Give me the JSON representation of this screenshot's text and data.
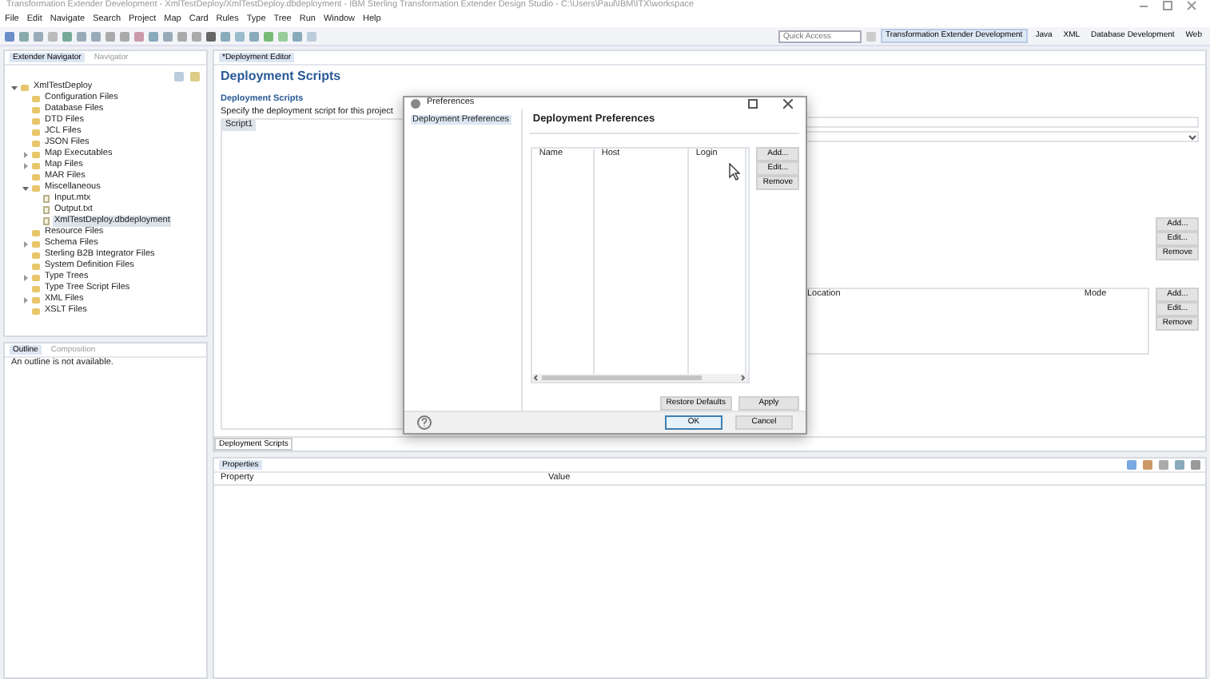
{
  "window": {
    "title": "Transformation Extender Development - XmlTestDeploy/XmlTestDeploy.dbdeployment - IBM Sterling Transformation Extender Design Studio - C:\\Users\\Paul\\IBM\\ITX\\workspace"
  },
  "menu": [
    "File",
    "Edit",
    "Navigate",
    "Search",
    "Project",
    "Map",
    "Card",
    "Rules",
    "Type",
    "Tree",
    "Run",
    "Window",
    "Help"
  ],
  "quick_access": {
    "placeholder": "Quick Access"
  },
  "perspectives": [
    {
      "label": "Transformation Extender Development",
      "selected": true
    },
    {
      "label": "Java",
      "selected": false
    },
    {
      "label": "XML",
      "selected": false
    },
    {
      "label": "Database Development",
      "selected": false
    },
    {
      "label": "Web",
      "selected": false
    }
  ],
  "navigator": {
    "tabs": [
      {
        "label": "Extender Navigator",
        "selected": true
      },
      {
        "label": "Navigator",
        "selected": false
      }
    ],
    "tree": [
      {
        "label": "XmlTestDeploy",
        "expanded": true,
        "selected": false,
        "children": [
          {
            "label": "Configuration Files",
            "selected": false
          },
          {
            "label": "Database Files",
            "selected": false
          },
          {
            "label": "DTD Files",
            "selected": false
          },
          {
            "label": "JCL Files",
            "selected": false
          },
          {
            "label": "JSON Files",
            "selected": false
          },
          {
            "label": "Map Executables",
            "expanded": false,
            "selected": false
          },
          {
            "label": "Map Files",
            "expanded": false,
            "selected": false
          },
          {
            "label": "MAR Files",
            "selected": false
          },
          {
            "label": "Miscellaneous",
            "expanded": true,
            "selected": false,
            "children": [
              {
                "label": "Input.mtx",
                "selected": false
              },
              {
                "label": "Output.txt",
                "selected": false
              },
              {
                "label": "XmlTestDeploy.dbdeployment",
                "selected": true
              }
            ]
          },
          {
            "label": "Resource Files",
            "selected": false
          },
          {
            "label": "Schema Files",
            "expanded": false,
            "selected": false
          },
          {
            "label": "Sterling B2B Integrator Files",
            "selected": false
          },
          {
            "label": "System Definition Files",
            "selected": false
          },
          {
            "label": "Type Trees",
            "expanded": false,
            "selected": false
          },
          {
            "label": "Type Tree Script Files",
            "selected": false
          },
          {
            "label": "XML Files",
            "expanded": false,
            "selected": false
          },
          {
            "label": "XSLT Files",
            "selected": false
          }
        ]
      }
    ]
  },
  "outline": {
    "tabs": [
      {
        "label": "Outline",
        "selected": true
      },
      {
        "label": "Composition",
        "selected": false
      }
    ],
    "message": "An outline is not available."
  },
  "editor": {
    "tab": "*Deployment Editor",
    "heading": "Deployment Scripts",
    "scripts_section": {
      "title": "Deployment Scripts",
      "description": "Specify the deployment script for this project",
      "items": [
        {
          "label": "Script1",
          "selected": true
        }
      ]
    },
    "buttons_upper": [
      "Add...",
      "Edit...",
      "Remove"
    ],
    "location_table": {
      "columns": [
        "Location",
        "Mode"
      ]
    },
    "buttons_lower": [
      "Add...",
      "Edit...",
      "Remove"
    ],
    "bottom_tabs": [
      {
        "label": "Deployment Scripts",
        "selected": true
      }
    ]
  },
  "properties": {
    "tab": "Properties",
    "columns": [
      "Property",
      "Value"
    ]
  },
  "dialog": {
    "title": "Preferences",
    "tree": [
      {
        "label": "Deployment Preferences",
        "selected": true
      }
    ],
    "page_title": "Deployment Preferences",
    "table": {
      "columns": [
        "Name",
        "Host",
        "Login"
      ]
    },
    "side_buttons": [
      "Add...",
      "Edit...",
      "Remove"
    ],
    "page_buttons": [
      "Restore Defaults",
      "Apply"
    ],
    "buttons": [
      {
        "label": "OK",
        "kind": "default"
      },
      {
        "label": "Cancel",
        "kind": "normal"
      }
    ]
  }
}
